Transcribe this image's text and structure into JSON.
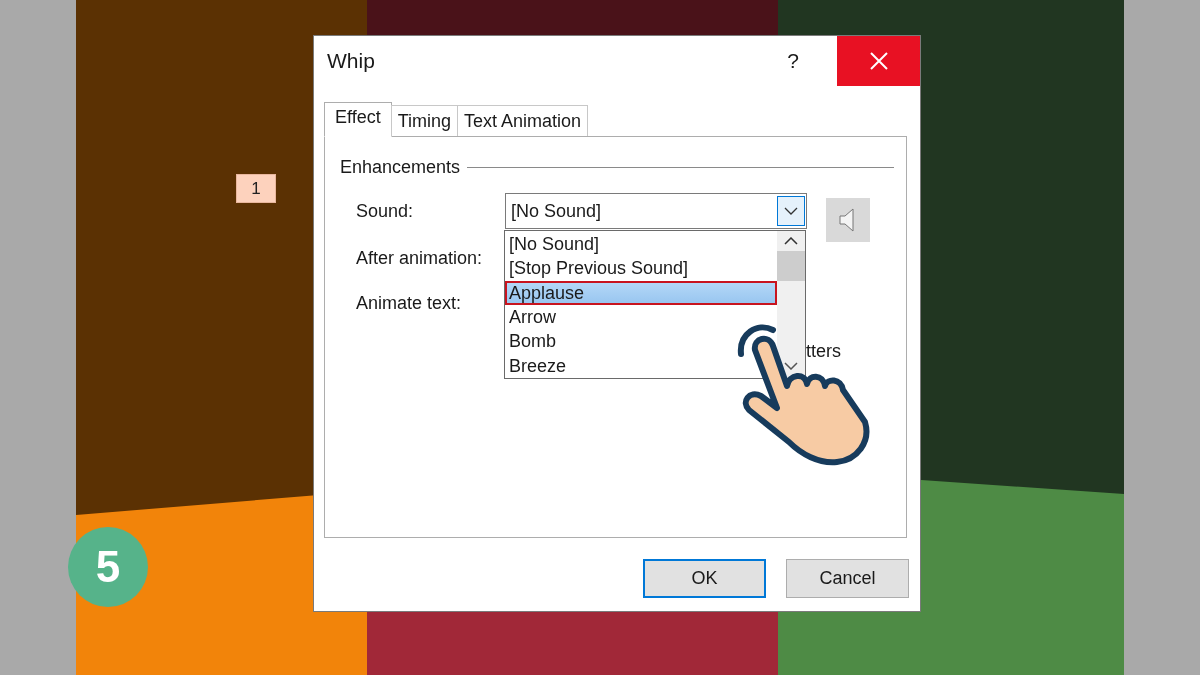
{
  "slide": {
    "badge": "1",
    "step": "5"
  },
  "dialog": {
    "title": "Whip",
    "help": "?"
  },
  "tabs": [
    {
      "label": "Effect",
      "selected": true
    },
    {
      "label": "Timing",
      "selected": false
    },
    {
      "label": "Text Animation",
      "selected": false
    }
  ],
  "group": {
    "title": "Enhancements"
  },
  "fields": [
    {
      "label": "Sound:",
      "kind": "dropdown",
      "value": "[No Sound]"
    },
    {
      "label": "After animation:",
      "kind": "label"
    },
    {
      "label": "Animate text:",
      "kind": "label"
    }
  ],
  "dropdown_list": {
    "items": [
      {
        "label": "[No Sound]",
        "selected": false
      },
      {
        "label": "[Stop Previous Sound]",
        "selected": false
      },
      {
        "label": "Applause",
        "selected": true
      },
      {
        "label": "Arrow",
        "selected": false
      },
      {
        "label": "Bomb",
        "selected": false
      },
      {
        "label": "Breeze",
        "selected": false
      }
    ]
  },
  "hidden_option": {
    "label": "tters"
  },
  "buttons": [
    {
      "label": "OK",
      "default": true
    },
    {
      "label": "Cancel",
      "default": false
    }
  ]
}
